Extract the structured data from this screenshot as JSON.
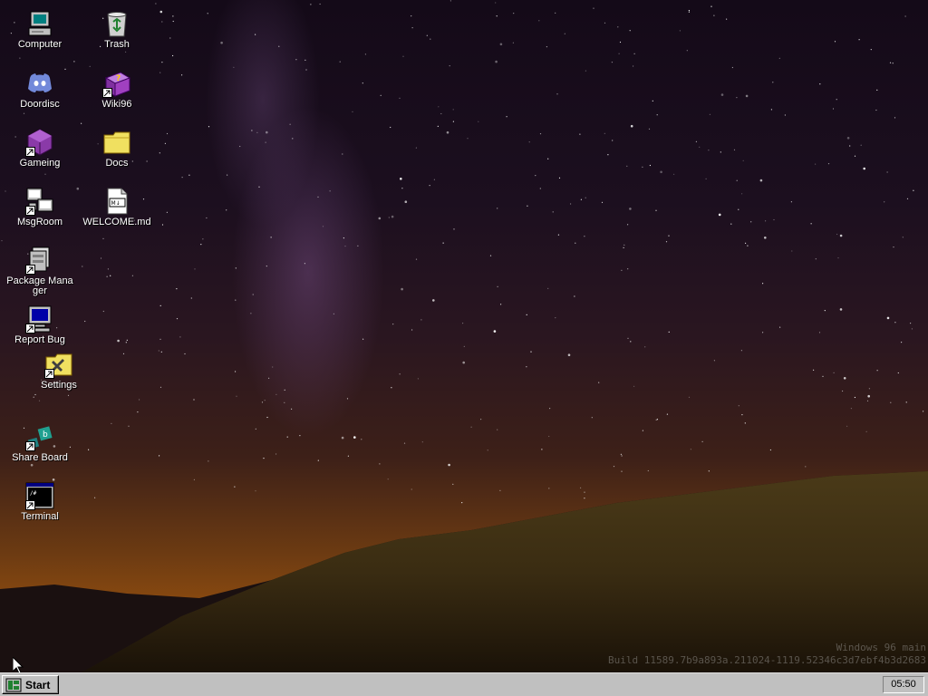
{
  "desktop": {
    "icons": [
      {
        "label": "Computer",
        "icon": "computer-icon",
        "shortcut": false
      },
      {
        "label": "Trash",
        "icon": "recycle-bin-icon",
        "shortcut": false
      },
      {
        "label": "Doordisc",
        "icon": "discord-icon",
        "shortcut": false
      },
      {
        "label": "Wiki96",
        "icon": "help-book-icon",
        "shortcut": true
      },
      {
        "label": "Gameing",
        "icon": "game-cube-icon",
        "shortcut": true
      },
      {
        "label": "Docs",
        "icon": "folder-icon",
        "shortcut": false
      },
      {
        "label": "MsgRoom",
        "icon": "chat-computers-icon",
        "shortcut": true
      },
      {
        "label": "WELCOME.md",
        "icon": "markdown-file-icon",
        "shortcut": false
      },
      {
        "label": "Package Manager",
        "icon": "package-icon",
        "shortcut": true
      },
      {
        "label": "Report Bug",
        "icon": "monitor-icon",
        "shortcut": true
      },
      {
        "label": "Settings",
        "icon": "settings-folder-icon",
        "shortcut": true
      },
      {
        "label": "Share Board",
        "icon": "share-board-icon",
        "shortcut": true
      },
      {
        "label": "Terminal",
        "icon": "terminal-icon",
        "shortcut": true
      }
    ]
  },
  "watermark": {
    "line1": "Windows 96 main",
    "line2": "Build 11589.7b9a893a.211024-1119.52346c3d7ebf4b3d2683"
  },
  "taskbar": {
    "start_label": "Start",
    "clock": "05:50"
  },
  "colors": {
    "taskbar": "#c0c0c0",
    "folder": "#f0e060",
    "terminal_bg": "#000000",
    "discord": "#7289da"
  }
}
